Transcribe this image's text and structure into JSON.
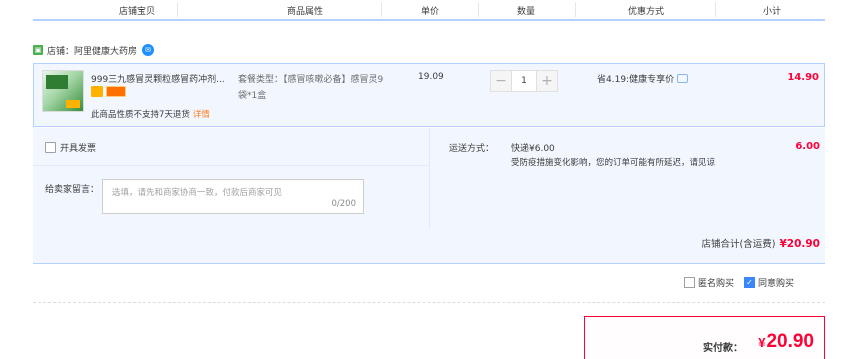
{
  "columns": [
    "店铺宝贝",
    "商品属性",
    "单价",
    "数量",
    "优惠方式",
    "小计"
  ],
  "shop": {
    "icon": "shop-icon",
    "label": "店铺：阿里健康大药房",
    "chat_icon": "wangwang-icon"
  },
  "item": {
    "title": "999三九感冒灵颗粒感冒药冲剂...",
    "attr": "套餐类型：【感冒咳嗽必备】感冒灵9袋*1盒",
    "price": "19.09",
    "quantity": "1",
    "minus": "−",
    "plus": "+",
    "promo": "省4.19:健康专享价",
    "subtotal": "14.90",
    "note": "此商品性质不支持7天退货",
    "detail_link": "详情"
  },
  "invoice_label": "开具发票",
  "message": {
    "label": "给卖家留言：",
    "placeholder": "选填，请先和商家协商一致，付款后商家可见",
    "counter": "0/200"
  },
  "shipping": {
    "label": "运送方式：",
    "method": "快递¥6.00",
    "fee": "6.00",
    "note": "受防疫措施变化影响，您的订单可能有所延迟，请见谅"
  },
  "shop_total": {
    "label": "店铺合计(含运费)",
    "value": "¥20.90"
  },
  "options": [
    {
      "label": "匿名购买",
      "checked": false
    },
    {
      "label": "同意购买",
      "checked": true
    }
  ],
  "payment": {
    "label": "实付款：",
    "currency": "¥",
    "value": "20.90"
  },
  "colors": {
    "accent": "#ff0036",
    "border": "#b2d1ff",
    "panel_bg": "#f2f7ff"
  }
}
